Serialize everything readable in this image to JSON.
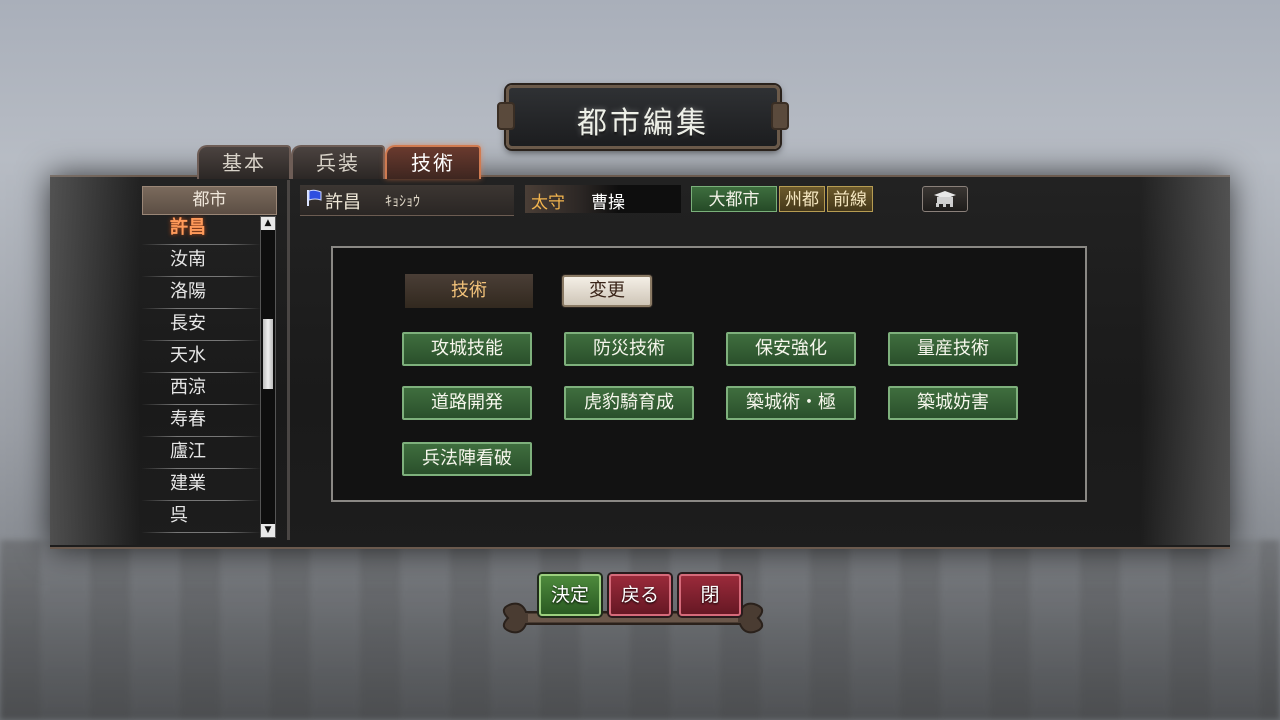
{
  "window": {
    "title": "都市編集"
  },
  "tabs": [
    {
      "label": "基本"
    },
    {
      "label": "兵装"
    },
    {
      "label": "技術",
      "active": true
    }
  ],
  "city_list": {
    "header": "都市",
    "items": [
      "許昌",
      "汝南",
      "洛陽",
      "長安",
      "天水",
      "西涼",
      "寿春",
      "廬江",
      "建業",
      "呉"
    ],
    "selected_index": 0
  },
  "info": {
    "city_name": "許昌",
    "city_reading": "ｷｮｼｮｳ",
    "governor_label": "太守",
    "governor_name": "曹操",
    "badges": [
      "大都市",
      "州都",
      "前線"
    ]
  },
  "tech": {
    "label": "技術",
    "change_button": "変更",
    "items": [
      "攻城技能",
      "防災技術",
      "保安強化",
      "量産技術",
      "道路開発",
      "虎豹騎育成",
      "築城術・極",
      "築城妨害",
      "兵法陣看破"
    ]
  },
  "commands": {
    "ok": "決定",
    "back": "戻る",
    "close": "閉"
  },
  "colors": {
    "accent_orange": "#ff9a5a",
    "tech_green": "#3f6e3e",
    "governor_gold": "#f2b44e",
    "cancel_red": "#9a2a3a"
  },
  "icons": [
    "flag-icon",
    "hat-icon",
    "scroll-up-icon",
    "scroll-down-icon"
  ]
}
